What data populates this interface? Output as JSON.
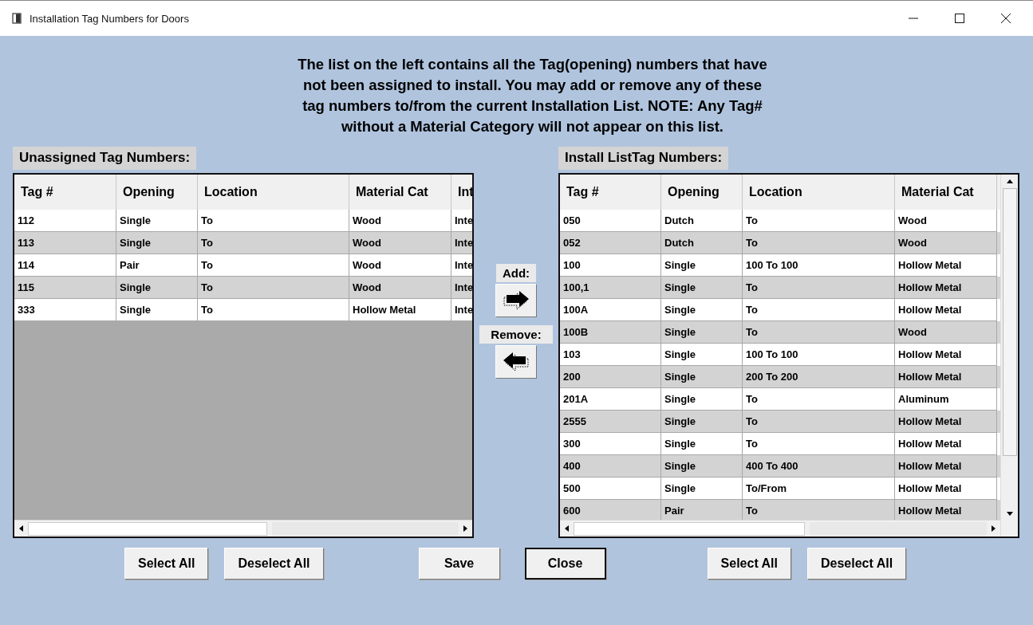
{
  "window": {
    "title": "Installation Tag Numbers for Doors"
  },
  "instructions": [
    "The list on the left contains all the Tag(opening) numbers that have",
    "not been assigned to install.  You  may add or remove any of these",
    "tag numbers to/from the current Installation List.  NOTE:  Any Tag#",
    "without a Material Category will not appear on this list."
  ],
  "unassigned": {
    "label": "Unassigned Tag Numbers:",
    "columns": [
      "Tag #",
      "Opening",
      "Location",
      "Material Cat",
      "Int"
    ],
    "rows": [
      [
        "112",
        "Single",
        "To",
        "Wood",
        "Inte"
      ],
      [
        "113",
        "Single",
        "To",
        "Wood",
        "Inte"
      ],
      [
        "114",
        "Pair",
        "To",
        "Wood",
        "Inte"
      ],
      [
        "115",
        "Single",
        "To",
        "Wood",
        "Inte"
      ],
      [
        "333",
        "Single",
        "To",
        "Hollow Metal",
        "Inte"
      ]
    ]
  },
  "add": {
    "label": "Add:"
  },
  "remove": {
    "label": "Remove:"
  },
  "install_list": {
    "label": "Install ListTag Numbers:",
    "columns": [
      "Tag #",
      "Opening",
      "Location",
      "Material Cat"
    ],
    "rows": [
      [
        "050",
        "Dutch",
        "To",
        "Wood"
      ],
      [
        "052",
        "Dutch",
        "To",
        "Wood"
      ],
      [
        "100",
        "Single",
        "100 To 100",
        "Hollow Metal"
      ],
      [
        "100,1",
        "Single",
        "To",
        "Hollow Metal"
      ],
      [
        "100A",
        "Single",
        "To",
        "Hollow Metal"
      ],
      [
        "100B",
        "Single",
        "To",
        "Wood"
      ],
      [
        "103",
        "Single",
        "100 To 100",
        "Hollow Metal"
      ],
      [
        "200",
        "Single",
        "200 To 200",
        "Hollow Metal"
      ],
      [
        "201A",
        "Single",
        "To",
        "Aluminum"
      ],
      [
        "2555",
        "Single",
        "To",
        "Hollow Metal"
      ],
      [
        "300",
        "Single",
        "To",
        "Hollow Metal"
      ],
      [
        "400",
        "Single",
        "400 To 400",
        "Hollow Metal"
      ],
      [
        "500",
        "Single",
        "To/From",
        "Hollow Metal"
      ],
      [
        "600",
        "Pair",
        "To",
        "Hollow Metal"
      ]
    ]
  },
  "button_groups": [
    [
      {
        "label": "Select All",
        "focused": false
      },
      {
        "label": "Deselect All",
        "focused": false
      }
    ],
    [
      {
        "label": "Save",
        "focused": false
      },
      {
        "label": "Close",
        "focused": true
      }
    ],
    [
      {
        "label": "Select All",
        "focused": false
      },
      {
        "label": "Deselect All",
        "focused": false
      }
    ]
  ]
}
